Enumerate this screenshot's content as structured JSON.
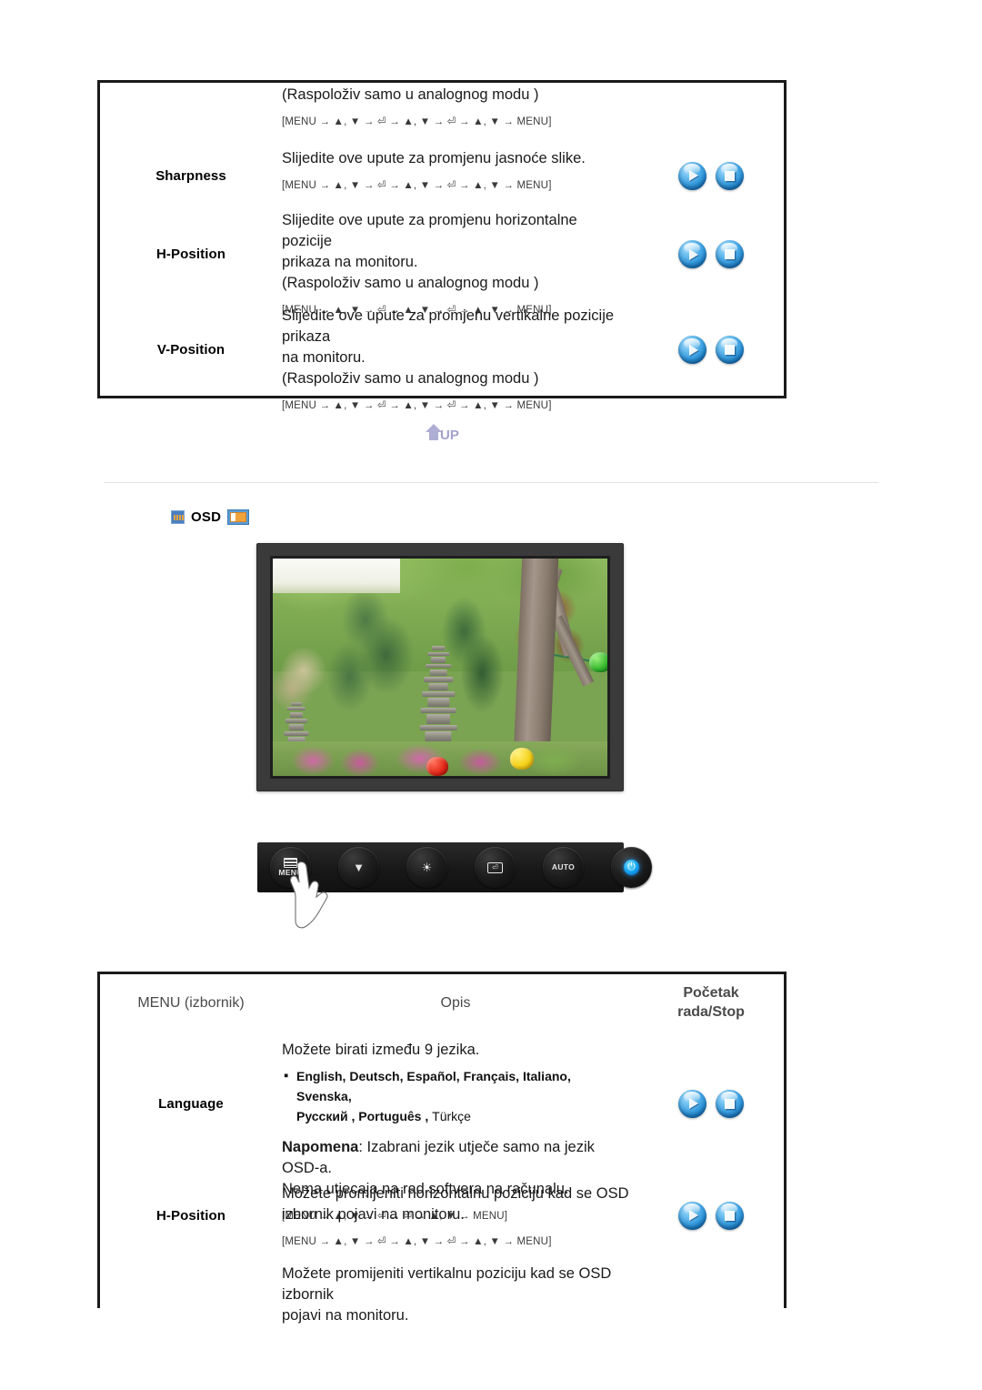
{
  "top_table": {
    "rows": [
      {
        "menu": "",
        "desc_lines": [
          "(Raspoloživ samo u analognog modu )"
        ],
        "nav": "[MENU → ▲, ▼ → ⏎ → ▲, ▼ → ⏎ → ▲, ▼ → MENU]",
        "has_buttons": false
      },
      {
        "menu": "Sharpness",
        "desc_lines": [
          "Slijedite ove upute za promjenu jasnoće slike."
        ],
        "nav": "[MENU → ▲, ▼ → ⏎ → ▲, ▼ → ⏎ → ▲, ▼ → MENU]",
        "has_buttons": true
      },
      {
        "menu": "H-Position",
        "desc_lines": [
          "Slijedite ove upute za promjenu horizontalne pozicije",
          "prikaza na monitoru.",
          "(Raspoloživ samo u analognog modu )"
        ],
        "nav": "[MENU → ▲, ▼ → ⏎ → ▲, ▼ → ⏎ → ▲, ▼ → MENU]",
        "has_buttons": true
      },
      {
        "menu": "V-Position",
        "desc_lines": [
          "Slijedite ove upute za promjenu vertikalne pozicije prikaza",
          "na monitoru.",
          "(Raspoloživ samo u analognog modu )"
        ],
        "nav": "[MENU → ▲, ▼ → ⏎ → ▲, ▼ → ⏎ → ▲, ▼ → MENU]",
        "has_buttons": true
      }
    ]
  },
  "up_badge": {
    "label": "UP"
  },
  "osd_section": {
    "title": "OSD"
  },
  "control_bar": {
    "buttons": [
      {
        "name": "menu-button",
        "label": "MENU",
        "icon": "menu-icon"
      },
      {
        "name": "down-button",
        "label": "",
        "icon": "down-arrow-icon"
      },
      {
        "name": "up-button",
        "label": "",
        "icon": "brightness-icon"
      },
      {
        "name": "enter-button",
        "label": "",
        "icon": "enter-icon"
      },
      {
        "name": "auto-button",
        "label": "AUTO",
        "icon": ""
      },
      {
        "name": "power-button",
        "label": "",
        "icon": "power-icon"
      }
    ]
  },
  "bottom_table": {
    "headers": {
      "menu": "MENU (izbornik)",
      "desc": "Opis",
      "start_line1": "Početak",
      "start_line2": "rada/Stop"
    },
    "rows": [
      {
        "menu": "Language",
        "intro": "Možete birati između 9 jezika.",
        "langs_line1": "English, Deutsch, Español, Français,  Italiano, Svenska,",
        "langs_line2_a": "Русский , Português , ",
        "langs_line2_b": "Türkçe",
        "note_label": "Napomena",
        "note_text": ": Izabrani jezik utječe samo na jezik OSD-a.",
        "note_text2": "Nema utjecaja na rad softvera na računalu.",
        "nav": "[MENU → ▲, ▼ → ⏎ → ⏎ → ▲, ▼ → MENU]",
        "has_buttons": true
      },
      {
        "menu": "H-Position",
        "desc_lines": [
          "Možete promijeniti horizontalnu poziciju kad se OSD",
          "izbornik pojavi na monitoru."
        ],
        "nav": "[MENU → ▲, ▼ → ⏎ → ▲, ▼ → ⏎ → ▲, ▼ → MENU]",
        "has_buttons": true
      },
      {
        "menu": "",
        "desc_lines": [
          "Možete promijeniti vertikalnu poziciju kad se OSD izbornik",
          "pojavi na monitoru."
        ],
        "nav": "",
        "has_buttons": false
      }
    ]
  },
  "colors": {
    "border": "#1a1a1a",
    "accent_blue": "#3a9fe0",
    "osd_orange": "#f0a33a",
    "up_purple": "#a2a2cc",
    "divider": "#e2e2e2"
  }
}
